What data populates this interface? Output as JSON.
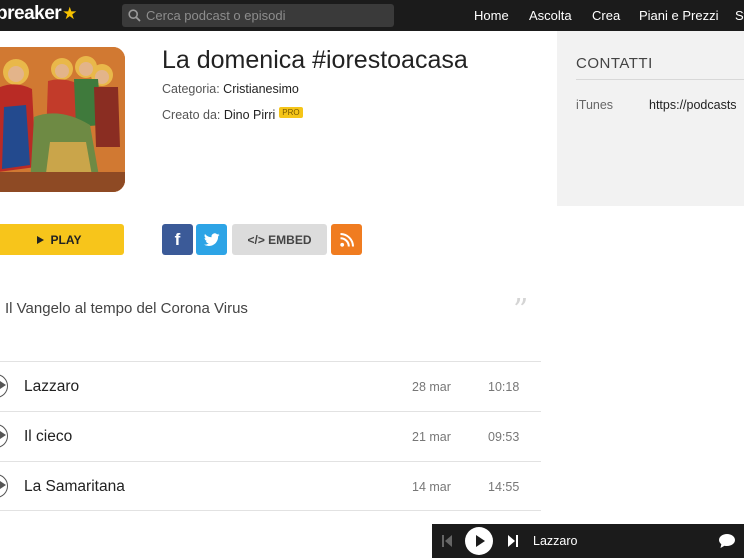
{
  "header": {
    "logo_text": "preaker",
    "logo_star": "★",
    "search_placeholder": "Cerca podcast o episodi",
    "nav": [
      "Home",
      "Ascolta",
      "Crea",
      "Piani e Prezzi",
      "St"
    ]
  },
  "podcast": {
    "title": "La domenica #iorestoacasa",
    "category_label": "Categoria:",
    "category": "Cristianesimo",
    "creator_label": "Creato da:",
    "creator": "Dino Pirri",
    "creator_badge": "PRO",
    "description": "Il Vangelo al tempo del Corona Virus",
    "quote_glyph": "”"
  },
  "actions": {
    "play_label": "PLAY",
    "facebook_glyph": "f",
    "embed_label": "</> EMBED"
  },
  "contacts": {
    "heading": "CONTATTI",
    "itunes_label": "iTunes",
    "itunes_value": "https://podcasts"
  },
  "episodes": [
    {
      "title": "Lazzaro",
      "date": "28 mar",
      "duration": "10:18"
    },
    {
      "title": "Il cieco",
      "date": "21 mar",
      "duration": "09:53"
    },
    {
      "title": "La Samaritana",
      "date": "14 mar",
      "duration": "14:55"
    }
  ],
  "player": {
    "now_playing": "Lazzaro"
  },
  "colors": {
    "topbar": "#1b1b1b",
    "accent_yellow": "#f7c51b",
    "facebook": "#3b5a98",
    "twitter": "#2da4e6",
    "rss": "#f07c20"
  }
}
